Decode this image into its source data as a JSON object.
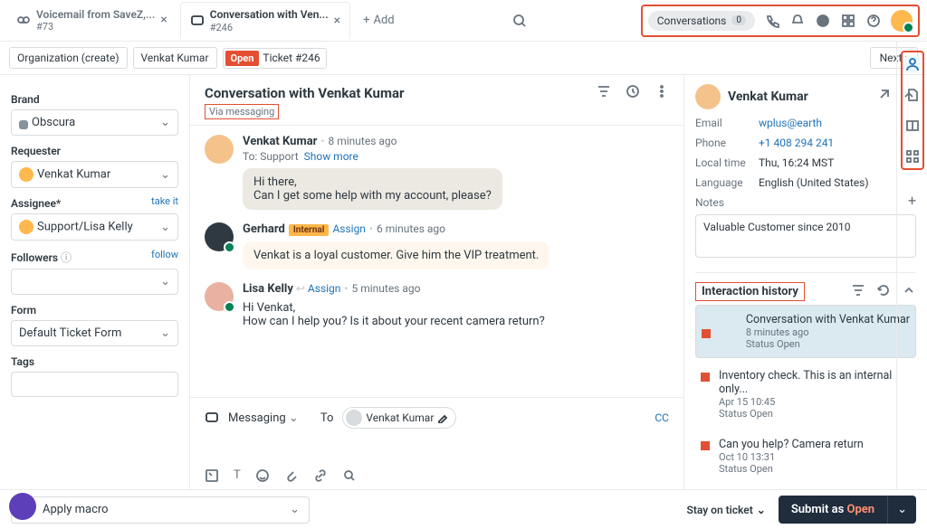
{
  "tabs": [
    {
      "line1": "Voicemail from SaveZ,...",
      "line2": "#73"
    },
    {
      "line1": "Conversation with Ven...",
      "line2": "#246"
    }
  ],
  "tab_add": "Add",
  "header": {
    "conversations": "Conversations",
    "count": "0"
  },
  "crumbs": {
    "org": "Organization (create)",
    "person": "Venkat Kumar",
    "open": "Open",
    "ticket": "Ticket #246",
    "next": "Next"
  },
  "left": {
    "brand_label": "Brand",
    "brand": "Obscura",
    "requester_label": "Requester",
    "requester": "Venkat Kumar",
    "assignee_label": "Assignee*",
    "takeit": "take it",
    "assignee": "Support/Lisa Kelly",
    "followers_label": "Followers",
    "follow": "follow",
    "form_label": "Form",
    "form": "Default Ticket Form",
    "tags_label": "Tags"
  },
  "center": {
    "title": "Conversation with Venkat Kumar",
    "via": "Via messaging",
    "m1": {
      "name": "Venkat Kumar",
      "time": "8 minutes ago",
      "to": "To: Support",
      "showmore": "Show more",
      "body": "Hi there,\nCan I get some help with my account, please?"
    },
    "m2": {
      "name": "Gerhard",
      "badge": "Internal",
      "assign": "Assign",
      "time": "6 minutes ago",
      "body": "Venkat is a loyal customer. Give him the VIP treatment."
    },
    "m3": {
      "name": "Lisa Kelly",
      "assign": "Assign",
      "time": "5 minutes ago",
      "body": "Hi Venkat,\nHow can I help you? Is it about your recent camera return?"
    },
    "compose": {
      "channel": "Messaging",
      "to_label": "To",
      "recipient": "Venkat Kumar",
      "cc": "CC"
    }
  },
  "right": {
    "name": "Venkat Kumar",
    "email_k": "Email",
    "email": "wplus@earth",
    "phone_k": "Phone",
    "phone": "+1 408 294 241",
    "localtime_k": "Local time",
    "localtime": "Thu, 16:24 MST",
    "lang_k": "Language",
    "lang": "English (United States)",
    "notes_k": "Notes",
    "notes": "Valuable Customer since 2010",
    "ih_title": "Interaction history",
    "items": [
      {
        "title": "Conversation with Venkat Kumar",
        "time": "8 minutes ago",
        "status": "Status Open"
      },
      {
        "title": "Inventory check. This is an internal only...",
        "time": "Apr 15 10:45",
        "status": "Status Open"
      },
      {
        "title": "Can you help? Camera return",
        "time": "Oct 10 13:31",
        "status": "Status Open"
      }
    ]
  },
  "footer": {
    "macro": "Apply macro",
    "stay": "Stay on ticket",
    "submit_pre": "Submit as ",
    "submit_status": "Open"
  }
}
